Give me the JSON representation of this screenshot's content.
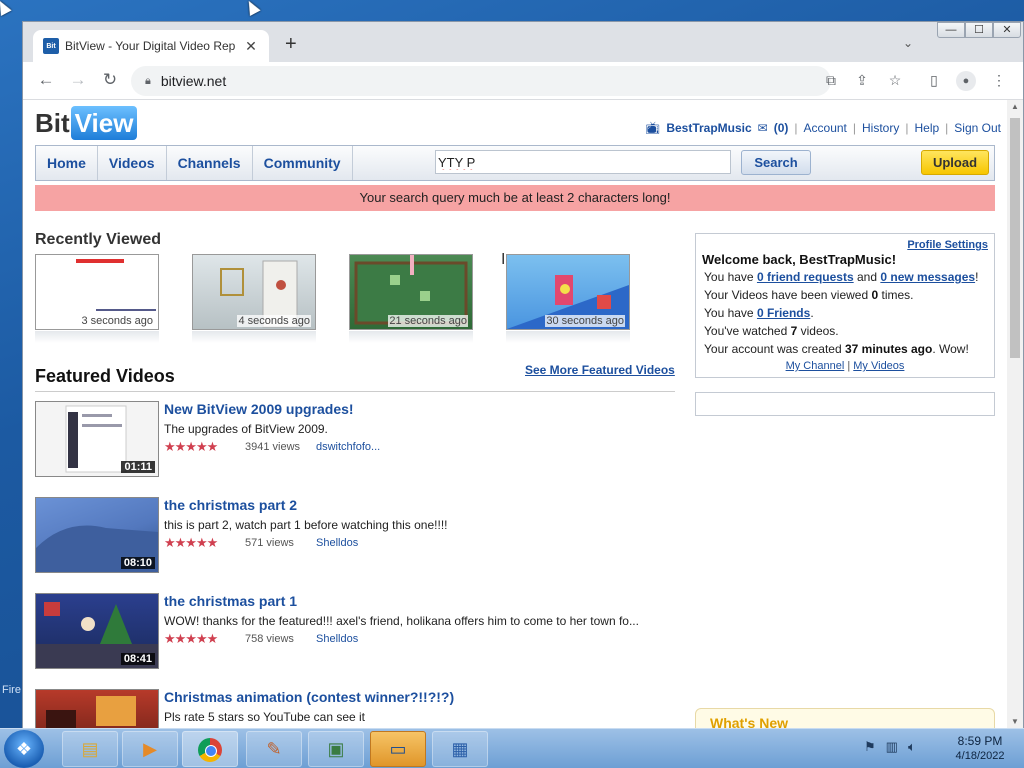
{
  "browser": {
    "tab_title": "BitView - Your Digital Video Rep",
    "tab_favicon": "Bit",
    "url": "bitview.net",
    "new_tab": "+",
    "window_buttons": {
      "minimize": "—",
      "maximize": "☐",
      "close": "✕"
    }
  },
  "site": {
    "logo_bit": "Bit",
    "logo_view": "View",
    "user": {
      "username": "BestTrapMusic",
      "inbox_count": "(0)",
      "account": "Account",
      "history": "History",
      "help": "Help",
      "sign_out": "Sign Out"
    },
    "nav": [
      "Home",
      "Videos",
      "Channels",
      "Community"
    ],
    "search": {
      "value": "YTY P",
      "button": "Search"
    },
    "upload": "Upload",
    "error": "Your search query much be at least 2 characters long!"
  },
  "recently_viewed": {
    "title": "Recently Viewed",
    "items": [
      {
        "time": "3 seconds ago"
      },
      {
        "time": "4 seconds ago"
      },
      {
        "time": "21 seconds ago"
      },
      {
        "time": "30 seconds ago"
      }
    ]
  },
  "featured": {
    "title": "Featured Videos",
    "see_more": "See More Featured Videos",
    "videos": [
      {
        "title": "New BitView 2009 upgrades!",
        "desc": "The upgrades of BitView 2009.",
        "views": "3941 views",
        "author": "dswitchfofo...",
        "duration": "01:11",
        "rating": 4.5
      },
      {
        "title": "the christmas part 2",
        "desc": "this is part 2, watch part 1 before watching this one!!!!",
        "views": "571 views",
        "author": "Shelldos",
        "duration": "08:10",
        "rating": 4.5
      },
      {
        "title": "the christmas part 1",
        "desc": "WOW! thanks for the featured!!! axel's friend, holikana offers him to come to her town fo...",
        "views": "758 views",
        "author": "Shelldos",
        "duration": "08:41",
        "rating": 4.5
      },
      {
        "title": "Christmas animation (contest winner?!!?!?)",
        "desc": "Pls rate 5 stars so YouTube can see it"
      }
    ]
  },
  "sidebar": {
    "profile_settings": "Profile Settings",
    "welcome": "Welcome back, BestTrapMusic!",
    "lines": {
      "l1_a": "You have ",
      "l1_link1": "0 friend requests",
      "l1_b": " and ",
      "l1_link2": "0 new messages",
      "l1_c": "!",
      "l2_a": "Your Videos have been viewed ",
      "l2_b": "0",
      "l2_c": " times.",
      "l3_a": "You have ",
      "l3_link": "0 Friends",
      "l3_b": ".",
      "l4_a": "You've watched ",
      "l4_b": "7",
      "l4_c": " videos.",
      "l5_a": "Your account was created ",
      "l5_b": "37 minutes ago",
      "l5_c": ". Wow!"
    },
    "my_channel": "My Channel",
    "my_videos": "My Videos",
    "link_sep": " | ",
    "whats_new": "What's New"
  },
  "taskbar": {
    "desktop_label": "Fire",
    "time": "8:59 PM",
    "date": "4/18/2022"
  },
  "colors": {
    "link": "#1c4f9e",
    "error_bg": "#f6a3a3",
    "upload_bg": "#f7c600",
    "star": "#d04050"
  }
}
